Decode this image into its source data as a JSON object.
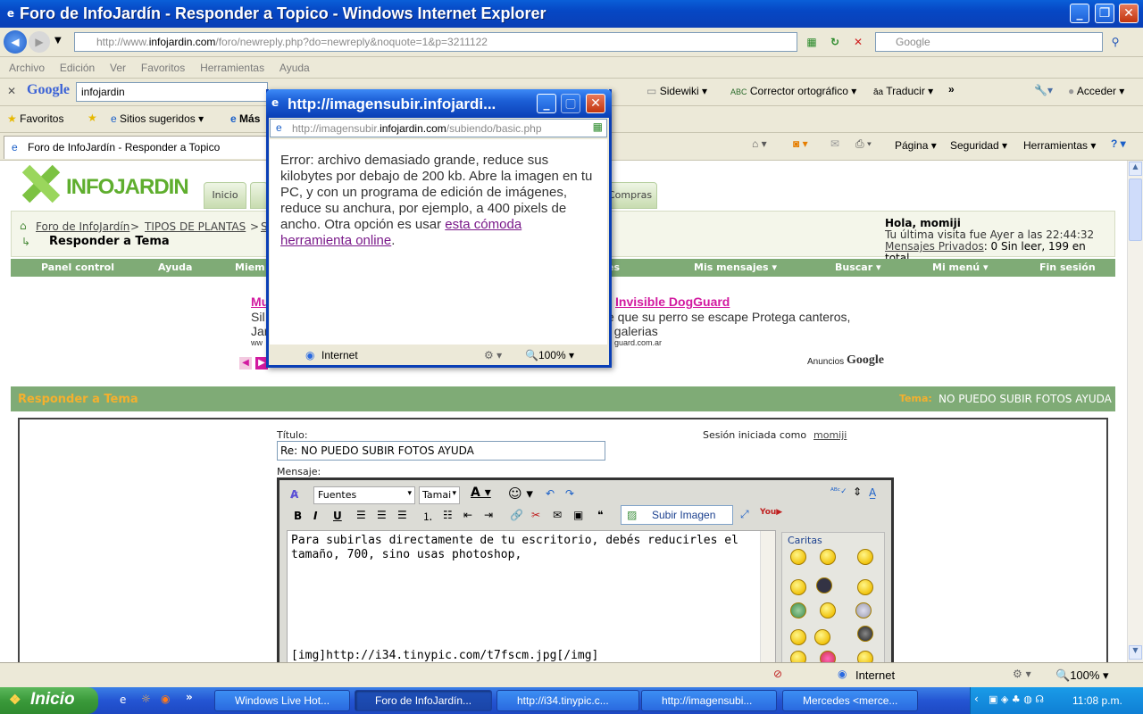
{
  "window": {
    "title": "Foro de InfoJardín - Responder a Topico - Windows Internet Explorer"
  },
  "address": {
    "prefix": "http://www.",
    "domain": "infojardin.com",
    "path": "/foro/newreply.php?do=newreply&noquote=1&p=3211122",
    "search_placeholder": "Google"
  },
  "menu": [
    "Archivo",
    "Edición",
    "Ver",
    "Favoritos",
    "Herramientas",
    "Ayuda"
  ],
  "google_bar": {
    "logo": "Google",
    "query": "infojardin",
    "sidewiki": "Sidewiki",
    "corrector": "Corrector ortográfico",
    "traducir": "Traducir",
    "acceder": "Acceder",
    "chevron": "»"
  },
  "favorites_bar": {
    "favoritos": "Favoritos",
    "sugeridos": "Sitios sugeridos",
    "mas": "Más"
  },
  "tab": {
    "title": "Foro de InfoJardín - Responder a Topico"
  },
  "command_bar": {
    "pagina": "Página",
    "seguridad": "Seguridad",
    "herramientas": "Herramientas"
  },
  "site": {
    "logo": "INFOJARDIN",
    "nav_tab": "Inicio",
    "nav_tab_right": "Compras",
    "breadcrumb": [
      "Foro de InfoJardín",
      "TIPOS DE PLANTAS"
    ],
    "breadcrumb_sep": ">",
    "breadcrumb_more": "S",
    "page_heading": "Responder a Tema",
    "user": {
      "greeting": "Hola, momiji",
      "last_visit_label": "Tu última visita fue Ayer a las",
      "last_visit_time": "22:44:32",
      "pm_link": "Mensajes Privados",
      "pm_rest": ": 0 Sin leer, 199 en total."
    },
    "green_nav": [
      "Panel control",
      "Ayuda",
      "Miem",
      "es",
      "Mis mensajes",
      "Buscar",
      "Mi menú",
      "Fin sesión"
    ],
    "ad": {
      "link_left": "Mu",
      "title": "Invisible DogGuard",
      "line1_left": "Sil",
      "line1": "e que su perro se escape Protega canteros,",
      "line2_left": "Jar",
      "line2": ", galerias",
      "url_left": "ww",
      "url": "guard.com.ar",
      "anuncios": "Anuncios",
      "google": "Google"
    },
    "reply": {
      "header": "Responder a Tema",
      "tema_label": "Tema:",
      "tema_value": "NO PUEDO SUBIR FOTOS AYUDA",
      "titulo_label": "Título:",
      "titulo_value": "Re: NO PUEDO SUBIR FOTOS AYUDA",
      "session_label": "Sesión iniciada como",
      "session_user": "momiji",
      "mensaje_label": "Mensaje:"
    },
    "editor": {
      "font_select": "Fuentes",
      "size_select": "Tamai",
      "upload_button": "Subir Imagen",
      "text": "Para subirlas directamente de tu escritorio, debés reducirles el tamaño, 700, sino usas photoshop,",
      "img_tag": "[img]http://i34.tinypic.com/t7fscm.jpg[/img]",
      "caritas": "Caritas"
    }
  },
  "popup": {
    "title": "http://imagensubir.infojardi...",
    "url_prefix": "http://imagensubir.",
    "url_domain": "infojardin.com",
    "url_path": "/subiendo/basic.php",
    "error_text": "Error: archivo demasiado grande, reduce sus kilobytes por debajo de 200 kb. Abre la imagen en tu PC, y con un programa de edición de imágenes, reduce su anchura, por ejemplo, a 400 pixels de ancho. Otra opción es usar",
    "link_text": "esta cómoda herramienta online",
    "after_link": ".",
    "status_zone": "Internet",
    "zoom": "100%"
  },
  "status": {
    "zone": "Internet",
    "zoom": "100%"
  },
  "taskbar": {
    "start": "Inicio",
    "tasks": [
      "Windows Live Hot...",
      "Foro de InfoJardín...",
      "http://i34.tinypic.c...",
      "http://imagensubi...",
      "Mercedes <merce..."
    ],
    "time": "11:08 p.m."
  },
  "colors": {
    "green": "#7fab76",
    "orange_header": "#f4b02e",
    "xp_blue": "#0a3fb6",
    "link_purple": "#7a1a8a",
    "ad_pink": "#d21aa0"
  }
}
